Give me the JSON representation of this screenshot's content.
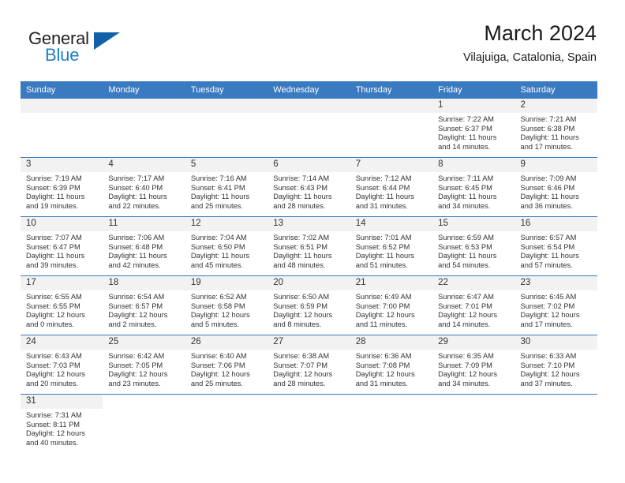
{
  "brand": {
    "name_part1": "General",
    "name_part2": "Blue",
    "triangle_color": "#1261a8",
    "blue_color": "#1d7fc4"
  },
  "header": {
    "title": "March 2024",
    "subtitle": "Vilajuiga, Catalonia, Spain"
  },
  "theme": {
    "header_bar_color": "#3a7ac0",
    "day_band_color": "#f2f2f2",
    "row_separator_color": "#3a7ac0"
  },
  "weekdays": [
    "Sunday",
    "Monday",
    "Tuesday",
    "Wednesday",
    "Thursday",
    "Friday",
    "Saturday"
  ],
  "weeks": [
    [
      {
        "day": "",
        "sunrise": "",
        "sunset": "",
        "daylight_line1": "",
        "daylight_line2": "",
        "empty": true
      },
      {
        "day": "",
        "sunrise": "",
        "sunset": "",
        "daylight_line1": "",
        "daylight_line2": "",
        "empty": true
      },
      {
        "day": "",
        "sunrise": "",
        "sunset": "",
        "daylight_line1": "",
        "daylight_line2": "",
        "empty": true
      },
      {
        "day": "",
        "sunrise": "",
        "sunset": "",
        "daylight_line1": "",
        "daylight_line2": "",
        "empty": true
      },
      {
        "day": "",
        "sunrise": "",
        "sunset": "",
        "daylight_line1": "",
        "daylight_line2": "",
        "empty": true
      },
      {
        "day": "1",
        "sunrise": "Sunrise: 7:22 AM",
        "sunset": "Sunset: 6:37 PM",
        "daylight_line1": "Daylight: 11 hours",
        "daylight_line2": "and 14 minutes."
      },
      {
        "day": "2",
        "sunrise": "Sunrise: 7:21 AM",
        "sunset": "Sunset: 6:38 PM",
        "daylight_line1": "Daylight: 11 hours",
        "daylight_line2": "and 17 minutes."
      }
    ],
    [
      {
        "day": "3",
        "sunrise": "Sunrise: 7:19 AM",
        "sunset": "Sunset: 6:39 PM",
        "daylight_line1": "Daylight: 11 hours",
        "daylight_line2": "and 19 minutes."
      },
      {
        "day": "4",
        "sunrise": "Sunrise: 7:17 AM",
        "sunset": "Sunset: 6:40 PM",
        "daylight_line1": "Daylight: 11 hours",
        "daylight_line2": "and 22 minutes."
      },
      {
        "day": "5",
        "sunrise": "Sunrise: 7:16 AM",
        "sunset": "Sunset: 6:41 PM",
        "daylight_line1": "Daylight: 11 hours",
        "daylight_line2": "and 25 minutes."
      },
      {
        "day": "6",
        "sunrise": "Sunrise: 7:14 AM",
        "sunset": "Sunset: 6:43 PM",
        "daylight_line1": "Daylight: 11 hours",
        "daylight_line2": "and 28 minutes."
      },
      {
        "day": "7",
        "sunrise": "Sunrise: 7:12 AM",
        "sunset": "Sunset: 6:44 PM",
        "daylight_line1": "Daylight: 11 hours",
        "daylight_line2": "and 31 minutes."
      },
      {
        "day": "8",
        "sunrise": "Sunrise: 7:11 AM",
        "sunset": "Sunset: 6:45 PM",
        "daylight_line1": "Daylight: 11 hours",
        "daylight_line2": "and 34 minutes."
      },
      {
        "day": "9",
        "sunrise": "Sunrise: 7:09 AM",
        "sunset": "Sunset: 6:46 PM",
        "daylight_line1": "Daylight: 11 hours",
        "daylight_line2": "and 36 minutes."
      }
    ],
    [
      {
        "day": "10",
        "sunrise": "Sunrise: 7:07 AM",
        "sunset": "Sunset: 6:47 PM",
        "daylight_line1": "Daylight: 11 hours",
        "daylight_line2": "and 39 minutes."
      },
      {
        "day": "11",
        "sunrise": "Sunrise: 7:06 AM",
        "sunset": "Sunset: 6:48 PM",
        "daylight_line1": "Daylight: 11 hours",
        "daylight_line2": "and 42 minutes."
      },
      {
        "day": "12",
        "sunrise": "Sunrise: 7:04 AM",
        "sunset": "Sunset: 6:50 PM",
        "daylight_line1": "Daylight: 11 hours",
        "daylight_line2": "and 45 minutes."
      },
      {
        "day": "13",
        "sunrise": "Sunrise: 7:02 AM",
        "sunset": "Sunset: 6:51 PM",
        "daylight_line1": "Daylight: 11 hours",
        "daylight_line2": "and 48 minutes."
      },
      {
        "day": "14",
        "sunrise": "Sunrise: 7:01 AM",
        "sunset": "Sunset: 6:52 PM",
        "daylight_line1": "Daylight: 11 hours",
        "daylight_line2": "and 51 minutes."
      },
      {
        "day": "15",
        "sunrise": "Sunrise: 6:59 AM",
        "sunset": "Sunset: 6:53 PM",
        "daylight_line1": "Daylight: 11 hours",
        "daylight_line2": "and 54 minutes."
      },
      {
        "day": "16",
        "sunrise": "Sunrise: 6:57 AM",
        "sunset": "Sunset: 6:54 PM",
        "daylight_line1": "Daylight: 11 hours",
        "daylight_line2": "and 57 minutes."
      }
    ],
    [
      {
        "day": "17",
        "sunrise": "Sunrise: 6:55 AM",
        "sunset": "Sunset: 6:55 PM",
        "daylight_line1": "Daylight: 12 hours",
        "daylight_line2": "and 0 minutes."
      },
      {
        "day": "18",
        "sunrise": "Sunrise: 6:54 AM",
        "sunset": "Sunset: 6:57 PM",
        "daylight_line1": "Daylight: 12 hours",
        "daylight_line2": "and 2 minutes."
      },
      {
        "day": "19",
        "sunrise": "Sunrise: 6:52 AM",
        "sunset": "Sunset: 6:58 PM",
        "daylight_line1": "Daylight: 12 hours",
        "daylight_line2": "and 5 minutes."
      },
      {
        "day": "20",
        "sunrise": "Sunrise: 6:50 AM",
        "sunset": "Sunset: 6:59 PM",
        "daylight_line1": "Daylight: 12 hours",
        "daylight_line2": "and 8 minutes."
      },
      {
        "day": "21",
        "sunrise": "Sunrise: 6:49 AM",
        "sunset": "Sunset: 7:00 PM",
        "daylight_line1": "Daylight: 12 hours",
        "daylight_line2": "and 11 minutes."
      },
      {
        "day": "22",
        "sunrise": "Sunrise: 6:47 AM",
        "sunset": "Sunset: 7:01 PM",
        "daylight_line1": "Daylight: 12 hours",
        "daylight_line2": "and 14 minutes."
      },
      {
        "day": "23",
        "sunrise": "Sunrise: 6:45 AM",
        "sunset": "Sunset: 7:02 PM",
        "daylight_line1": "Daylight: 12 hours",
        "daylight_line2": "and 17 minutes."
      }
    ],
    [
      {
        "day": "24",
        "sunrise": "Sunrise: 6:43 AM",
        "sunset": "Sunset: 7:03 PM",
        "daylight_line1": "Daylight: 12 hours",
        "daylight_line2": "and 20 minutes."
      },
      {
        "day": "25",
        "sunrise": "Sunrise: 6:42 AM",
        "sunset": "Sunset: 7:05 PM",
        "daylight_line1": "Daylight: 12 hours",
        "daylight_line2": "and 23 minutes."
      },
      {
        "day": "26",
        "sunrise": "Sunrise: 6:40 AM",
        "sunset": "Sunset: 7:06 PM",
        "daylight_line1": "Daylight: 12 hours",
        "daylight_line2": "and 25 minutes."
      },
      {
        "day": "27",
        "sunrise": "Sunrise: 6:38 AM",
        "sunset": "Sunset: 7:07 PM",
        "daylight_line1": "Daylight: 12 hours",
        "daylight_line2": "and 28 minutes."
      },
      {
        "day": "28",
        "sunrise": "Sunrise: 6:36 AM",
        "sunset": "Sunset: 7:08 PM",
        "daylight_line1": "Daylight: 12 hours",
        "daylight_line2": "and 31 minutes."
      },
      {
        "day": "29",
        "sunrise": "Sunrise: 6:35 AM",
        "sunset": "Sunset: 7:09 PM",
        "daylight_line1": "Daylight: 12 hours",
        "daylight_line2": "and 34 minutes."
      },
      {
        "day": "30",
        "sunrise": "Sunrise: 6:33 AM",
        "sunset": "Sunset: 7:10 PM",
        "daylight_line1": "Daylight: 12 hours",
        "daylight_line2": "and 37 minutes."
      }
    ],
    [
      {
        "day": "31",
        "sunrise": "Sunrise: 7:31 AM",
        "sunset": "Sunset: 8:11 PM",
        "daylight_line1": "Daylight: 12 hours",
        "daylight_line2": "and 40 minutes."
      },
      {
        "day": "",
        "sunrise": "",
        "sunset": "",
        "daylight_line1": "",
        "daylight_line2": "",
        "empty": true,
        "blank": true
      },
      {
        "day": "",
        "sunrise": "",
        "sunset": "",
        "daylight_line1": "",
        "daylight_line2": "",
        "empty": true,
        "blank": true
      },
      {
        "day": "",
        "sunrise": "",
        "sunset": "",
        "daylight_line1": "",
        "daylight_line2": "",
        "empty": true,
        "blank": true
      },
      {
        "day": "",
        "sunrise": "",
        "sunset": "",
        "daylight_line1": "",
        "daylight_line2": "",
        "empty": true,
        "blank": true
      },
      {
        "day": "",
        "sunrise": "",
        "sunset": "",
        "daylight_line1": "",
        "daylight_line2": "",
        "empty": true,
        "blank": true
      },
      {
        "day": "",
        "sunrise": "",
        "sunset": "",
        "daylight_line1": "",
        "daylight_line2": "",
        "empty": true,
        "blank": true
      }
    ]
  ]
}
